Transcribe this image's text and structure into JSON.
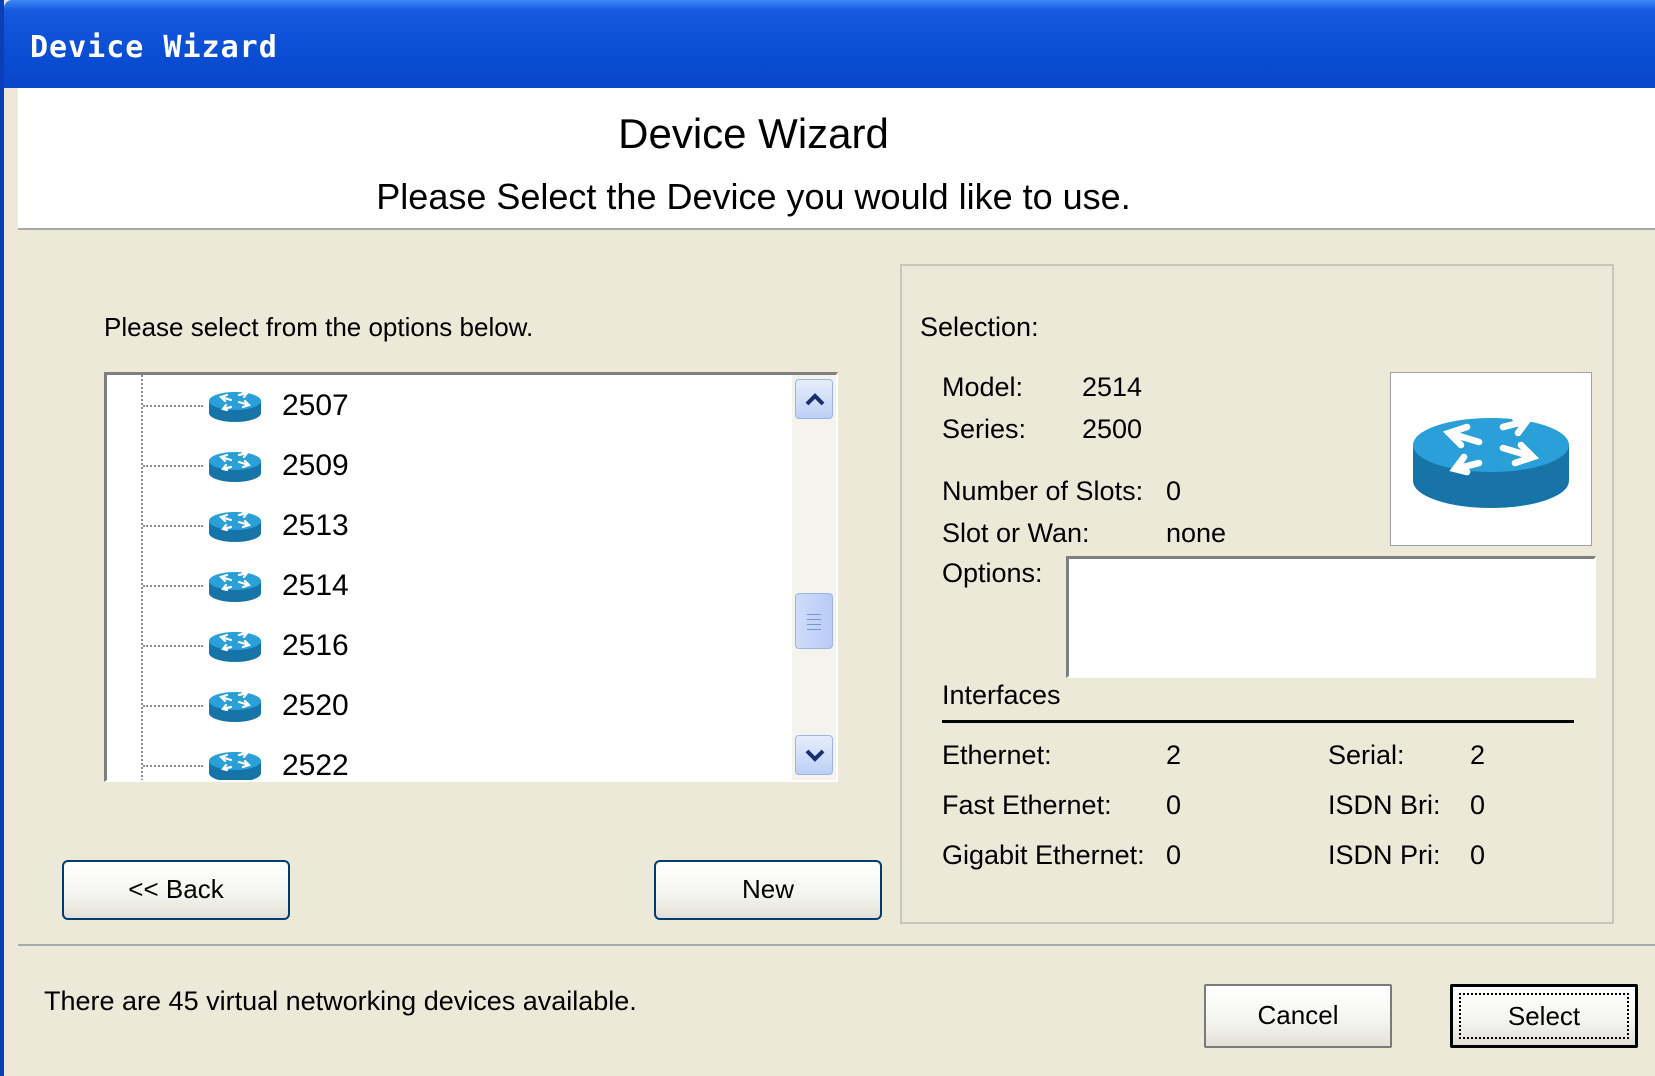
{
  "window": {
    "title": "Device Wizard"
  },
  "header": {
    "title": "Device Wizard",
    "subtitle": "Please Select the Device you would like to use."
  },
  "left": {
    "instruction": "Please select from the options below.",
    "tree_items": [
      {
        "label": "2507",
        "icon": "router-icon"
      },
      {
        "label": "2509",
        "icon": "router-icon"
      },
      {
        "label": "2513",
        "icon": "router-icon"
      },
      {
        "label": "2514",
        "icon": "router-icon"
      },
      {
        "label": "2516",
        "icon": "router-icon"
      },
      {
        "label": "2520",
        "icon": "router-icon"
      },
      {
        "label": "2522",
        "icon": "router-icon"
      }
    ],
    "back_label": "<< Back",
    "new_label": "New"
  },
  "selection": {
    "heading": "Selection:",
    "model_label": "Model:",
    "model_value": "2514",
    "series_label": "Series:",
    "series_value": "2500",
    "slots_label": "Number of Slots:",
    "slots_value": "0",
    "slotwan_label": "Slot or Wan:",
    "slotwan_value": "none",
    "options_label": "Options:",
    "options_value": "",
    "interfaces_heading": "Interfaces",
    "ethernet_label": "Ethernet:",
    "ethernet_value": "2",
    "fast_ethernet_label": "Fast Ethernet:",
    "fast_ethernet_value": "0",
    "gigabit_label": "Gigabit Ethernet:",
    "gigabit_value": "0",
    "serial_label": "Serial:",
    "serial_value": "2",
    "isdn_bri_label": "ISDN Bri:",
    "isdn_bri_value": "0",
    "isdn_pri_label": "ISDN Pri:",
    "isdn_pri_value": "0",
    "image_icon": "router-icon"
  },
  "footer": {
    "status": "There are 45 virtual networking devices available.",
    "cancel_label": "Cancel",
    "select_label": "Select"
  },
  "colors": {
    "titlebar": "#0a4ed4",
    "dialog_bg": "#ece9d8",
    "router_blue": "#1e8ec9"
  }
}
